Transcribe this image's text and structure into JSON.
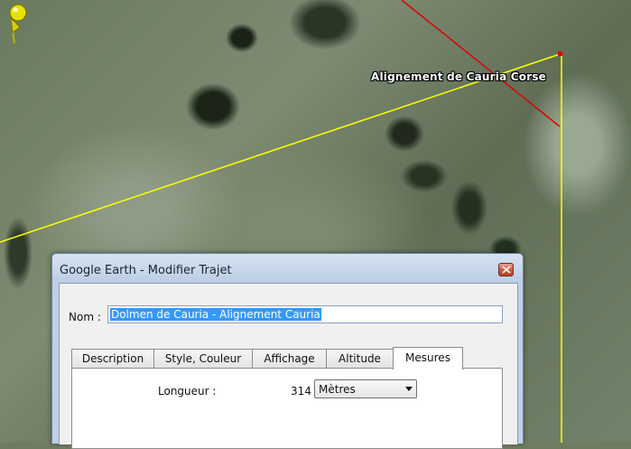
{
  "map": {
    "placemark_label": "Alignement de Cauria Corse",
    "colors": {
      "path_yellow": "#ffff00",
      "path_red": "#e00000",
      "pin": "#e8e000"
    },
    "icons": [
      "pushpin-icon"
    ]
  },
  "dialog": {
    "title": "Google Earth - Modifier Trajet",
    "name_label": "Nom :",
    "name_value": "Dolmen de Cauria - Alignement Cauria",
    "tabs": [
      {
        "label": "Description",
        "active": false
      },
      {
        "label": "Style, Couleur",
        "active": false
      },
      {
        "label": "Affichage",
        "active": false
      },
      {
        "label": "Altitude",
        "active": false
      },
      {
        "label": "Mesures",
        "active": true
      }
    ],
    "measures": {
      "length_label": "Longueur :",
      "length_value": "314",
      "unit_selected": "Mètres"
    },
    "icons": [
      "close-icon",
      "dropdown-arrow-icon"
    ]
  }
}
